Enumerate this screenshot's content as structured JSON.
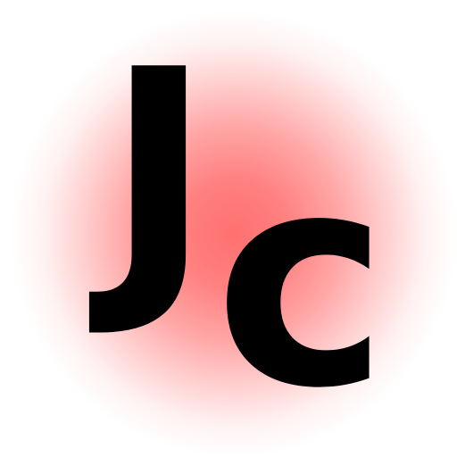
{
  "icon": {
    "letters": {
      "first": "J",
      "second": "c"
    },
    "colors": {
      "glow_center": "#ff7070",
      "background": "#ffffff",
      "text": "#000000"
    }
  }
}
